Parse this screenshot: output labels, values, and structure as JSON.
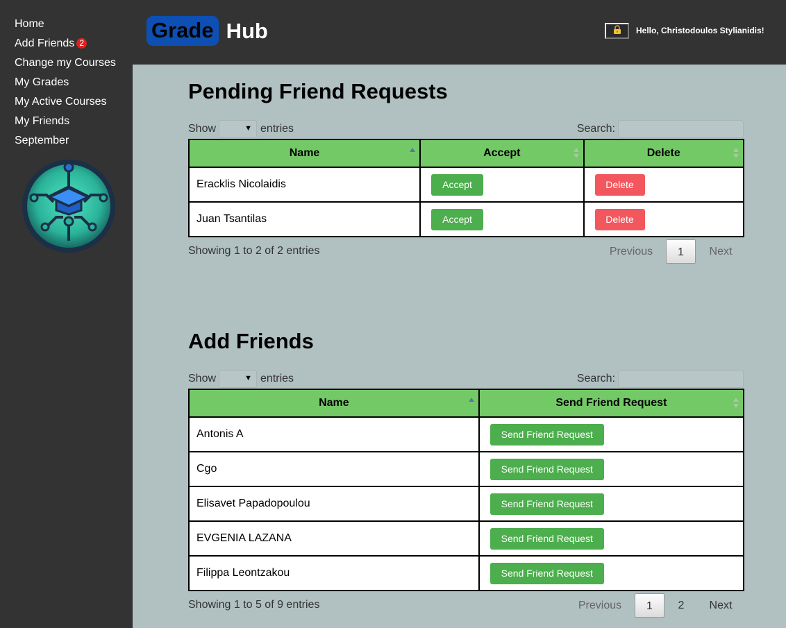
{
  "sidebar": {
    "items": [
      {
        "label": "Home"
      },
      {
        "label": "Add Friends",
        "badge": "2"
      },
      {
        "label": "Change my Courses"
      },
      {
        "label": "My Grades"
      },
      {
        "label": "My Active Courses"
      },
      {
        "label": "My Friends"
      },
      {
        "label": "September"
      }
    ],
    "logo_icon": "graduation-cap-circuit-logo"
  },
  "header": {
    "brand_part1": "Grade",
    "brand_part2": "Hub",
    "lock_icon": "lock-icon",
    "greeting": "Hello, Christodoulos Stylianidis!"
  },
  "pending": {
    "title": "Pending Friend Requests",
    "show_label": "Show",
    "entries_label": "entries",
    "search_label": "Search:",
    "columns": [
      "Name",
      "Accept",
      "Delete"
    ],
    "rows": [
      {
        "name": "Eracklis Nicolaidis",
        "accept": "Accept",
        "delete": "Delete"
      },
      {
        "name": "Juan Tsantilas",
        "accept": "Accept",
        "delete": "Delete"
      }
    ],
    "info": "Showing 1 to 2 of 2 entries",
    "pager": {
      "previous": "Previous",
      "pages": [
        "1"
      ],
      "next": "Next"
    }
  },
  "add_friends": {
    "title": "Add Friends",
    "show_label": "Show",
    "entries_label": "entries",
    "search_label": "Search:",
    "columns": [
      "Name",
      "Send Friend Request"
    ],
    "rows": [
      {
        "name": "Antonis A",
        "action": "Send Friend Request"
      },
      {
        "name": "Cgo",
        "action": "Send Friend Request"
      },
      {
        "name": "Elisavet Papadopoulou",
        "action": "Send Friend Request"
      },
      {
        "name": "EVGENIA LAZANA",
        "action": "Send Friend Request"
      },
      {
        "name": "Filippa Leontzakou",
        "action": "Send Friend Request"
      }
    ],
    "info": "Showing 1 to 5 of 9 entries",
    "pager": {
      "previous": "Previous",
      "pages": [
        "1",
        "2"
      ],
      "next": "Next"
    }
  },
  "colors": {
    "sidebar_bg": "#333333",
    "content_bg": "#b1c0c1",
    "table_header": "#74c967",
    "accept_green": "#4cae4c",
    "delete_red": "#f2575e",
    "brand_blue": "#0e4fb3"
  }
}
